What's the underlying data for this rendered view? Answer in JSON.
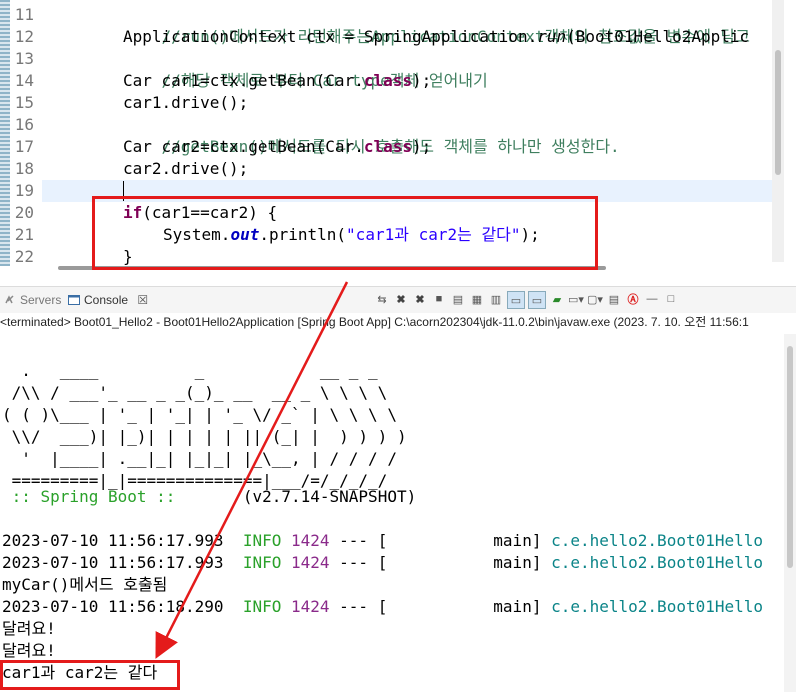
{
  "editor": {
    "line_numbers": [
      "11",
      "12",
      "13",
      "14",
      "15",
      "16",
      "17",
      "18",
      "19",
      "20",
      "21",
      "22"
    ],
    "lines": {
      "l11": {
        "comment": "//run()메서드가 리턴해주는ApplicationContext객체의 참조값을 변수에 담고"
      },
      "l12": {
        "a": "ApplicationContext ctx = SpringApplication.",
        "b": "run",
        "c": "(Boot01Hello2Applic"
      },
      "l13": {
        "comment": "//해당 객체로 부터 Car type객체 얻어내기"
      },
      "l14": {
        "a": "Car car1=ctx.getBean(Car.",
        "kw": "class",
        "b": ");"
      },
      "l15": {
        "a": "car1.drive();"
      },
      "l16": {
        "comment": "//getBean()메서드를 다시 호출해도 객체를 하나만 생성한다."
      },
      "l17": {
        "a": "Car car2=ctx.getBean(Car.",
        "kw": "class",
        "b": ");"
      },
      "l18": {
        "a": "car2.drive();"
      },
      "l20": {
        "kw": "if",
        "a": "(car1==car2) {"
      },
      "l21": {
        "a": "System.",
        "fld": "out",
        "b": ".println(",
        "str": "\"car1과 car2는 같다\"",
        "c": ");"
      },
      "l22": {
        "a": "}"
      }
    }
  },
  "views": {
    "servers_tab": "Servers",
    "console_tab": "Console",
    "close_glyph": "☒"
  },
  "console": {
    "status": "<terminated> Boot01_Hello2 - Boot01Hello2Application [Spring Boot App] C:\\acorn202304\\jdk-11.0.2\\bin\\javaw.exe (2023. 7. 10. 오전 11:56:1",
    "banner": [
      "  .   ____          _            __ _ _",
      " /\\\\ / ___'_ __ _ _(_)_ __  __ _ \\ \\ \\ \\",
      "( ( )\\___ | '_ | '_| | '_ \\/ _` | \\ \\ \\ \\",
      " \\\\/  ___)| |_)| | | | | || (_| |  ) ) ) )",
      "  '  |____| .__|_| |_|_| |_\\__, | / / / /",
      " =========|_|==============|___/=/_/_/_/"
    ],
    "spring_label": " :: Spring Boot :: ",
    "version": "      (v2.7.14-SNAPSHOT)",
    "logs": [
      {
        "ts": "2023-07-10 11:56:17.993  ",
        "level": "INFO",
        "pid": "1424",
        "mid": " --- [           main] ",
        "logger": "c.e.hello2.Boot01Hello"
      },
      {
        "ts": "2023-07-10 11:56:17.993  ",
        "level": "INFO",
        "pid": "1424",
        "mid": " --- [           main] ",
        "logger": "c.e.hello2.Boot01Hello"
      },
      {
        "ts": "2023-07-10 11:56:18.290  ",
        "level": "INFO",
        "pid": "1424",
        "mid": " --- [           main] ",
        "logger": "c.e.hello2.Boot01Hello"
      }
    ],
    "mycar_line": "myCar()메서드 호출됨",
    "drive1": "달려요!",
    "drive2": "달려요!",
    "result": "car1과 car2는 같다"
  },
  "colors": {
    "annotation": "#e41b1b",
    "comment": "#3f7f5f",
    "keyword": "#7f0055",
    "string": "#2a00ff"
  }
}
